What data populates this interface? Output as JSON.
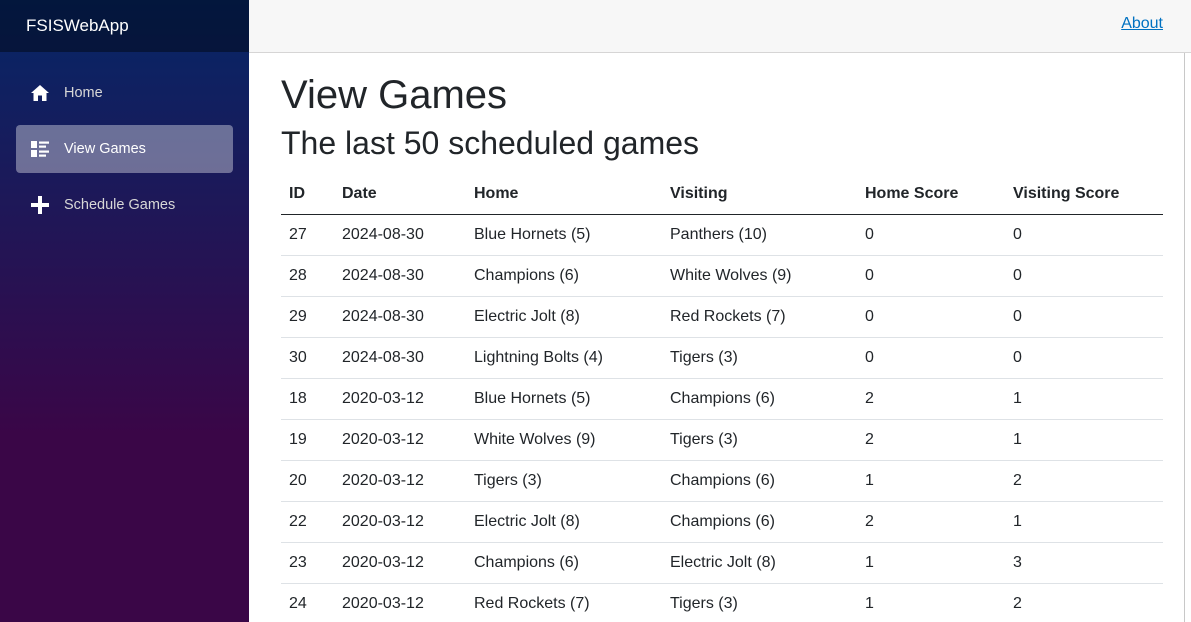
{
  "app": {
    "brand": "FSISWebApp"
  },
  "nav": {
    "items": [
      {
        "label": "Home",
        "icon": "home-icon"
      },
      {
        "label": "View Games",
        "icon": "list-icon",
        "active": true
      },
      {
        "label": "Schedule Games",
        "icon": "plus-icon"
      }
    ]
  },
  "topbar": {
    "about_label": "About"
  },
  "page": {
    "title": "View Games",
    "subtitle": "The last 50 scheduled games"
  },
  "table": {
    "headers": [
      "ID",
      "Date",
      "Home",
      "Visiting",
      "Home Score",
      "Visiting Score"
    ],
    "rows": [
      [
        "27",
        "2024-08-30",
        "Blue Hornets (5)",
        "Panthers (10)",
        "0",
        "0"
      ],
      [
        "28",
        "2024-08-30",
        "Champions (6)",
        "White Wolves (9)",
        "0",
        "0"
      ],
      [
        "29",
        "2024-08-30",
        "Electric Jolt (8)",
        "Red Rockets (7)",
        "0",
        "0"
      ],
      [
        "30",
        "2024-08-30",
        "Lightning Bolts (4)",
        "Tigers (3)",
        "0",
        "0"
      ],
      [
        "18",
        "2020-03-12",
        "Blue Hornets (5)",
        "Champions (6)",
        "2",
        "1"
      ],
      [
        "19",
        "2020-03-12",
        "White Wolves (9)",
        "Tigers (3)",
        "2",
        "1"
      ],
      [
        "20",
        "2020-03-12",
        "Tigers (3)",
        "Champions (6)",
        "1",
        "2"
      ],
      [
        "22",
        "2020-03-12",
        "Electric Jolt (8)",
        "Champions (6)",
        "2",
        "1"
      ],
      [
        "23",
        "2020-03-12",
        "Champions (6)",
        "Electric Jolt (8)",
        "1",
        "3"
      ],
      [
        "24",
        "2020-03-12",
        "Red Rockets (7)",
        "Tigers (3)",
        "1",
        "2"
      ]
    ]
  },
  "colors": {
    "sidebar_top": "#052767",
    "sidebar_bottom": "#3a0647",
    "link": "#0071c1",
    "active_nav_bg": "rgba(255,255,255,0.37)"
  }
}
